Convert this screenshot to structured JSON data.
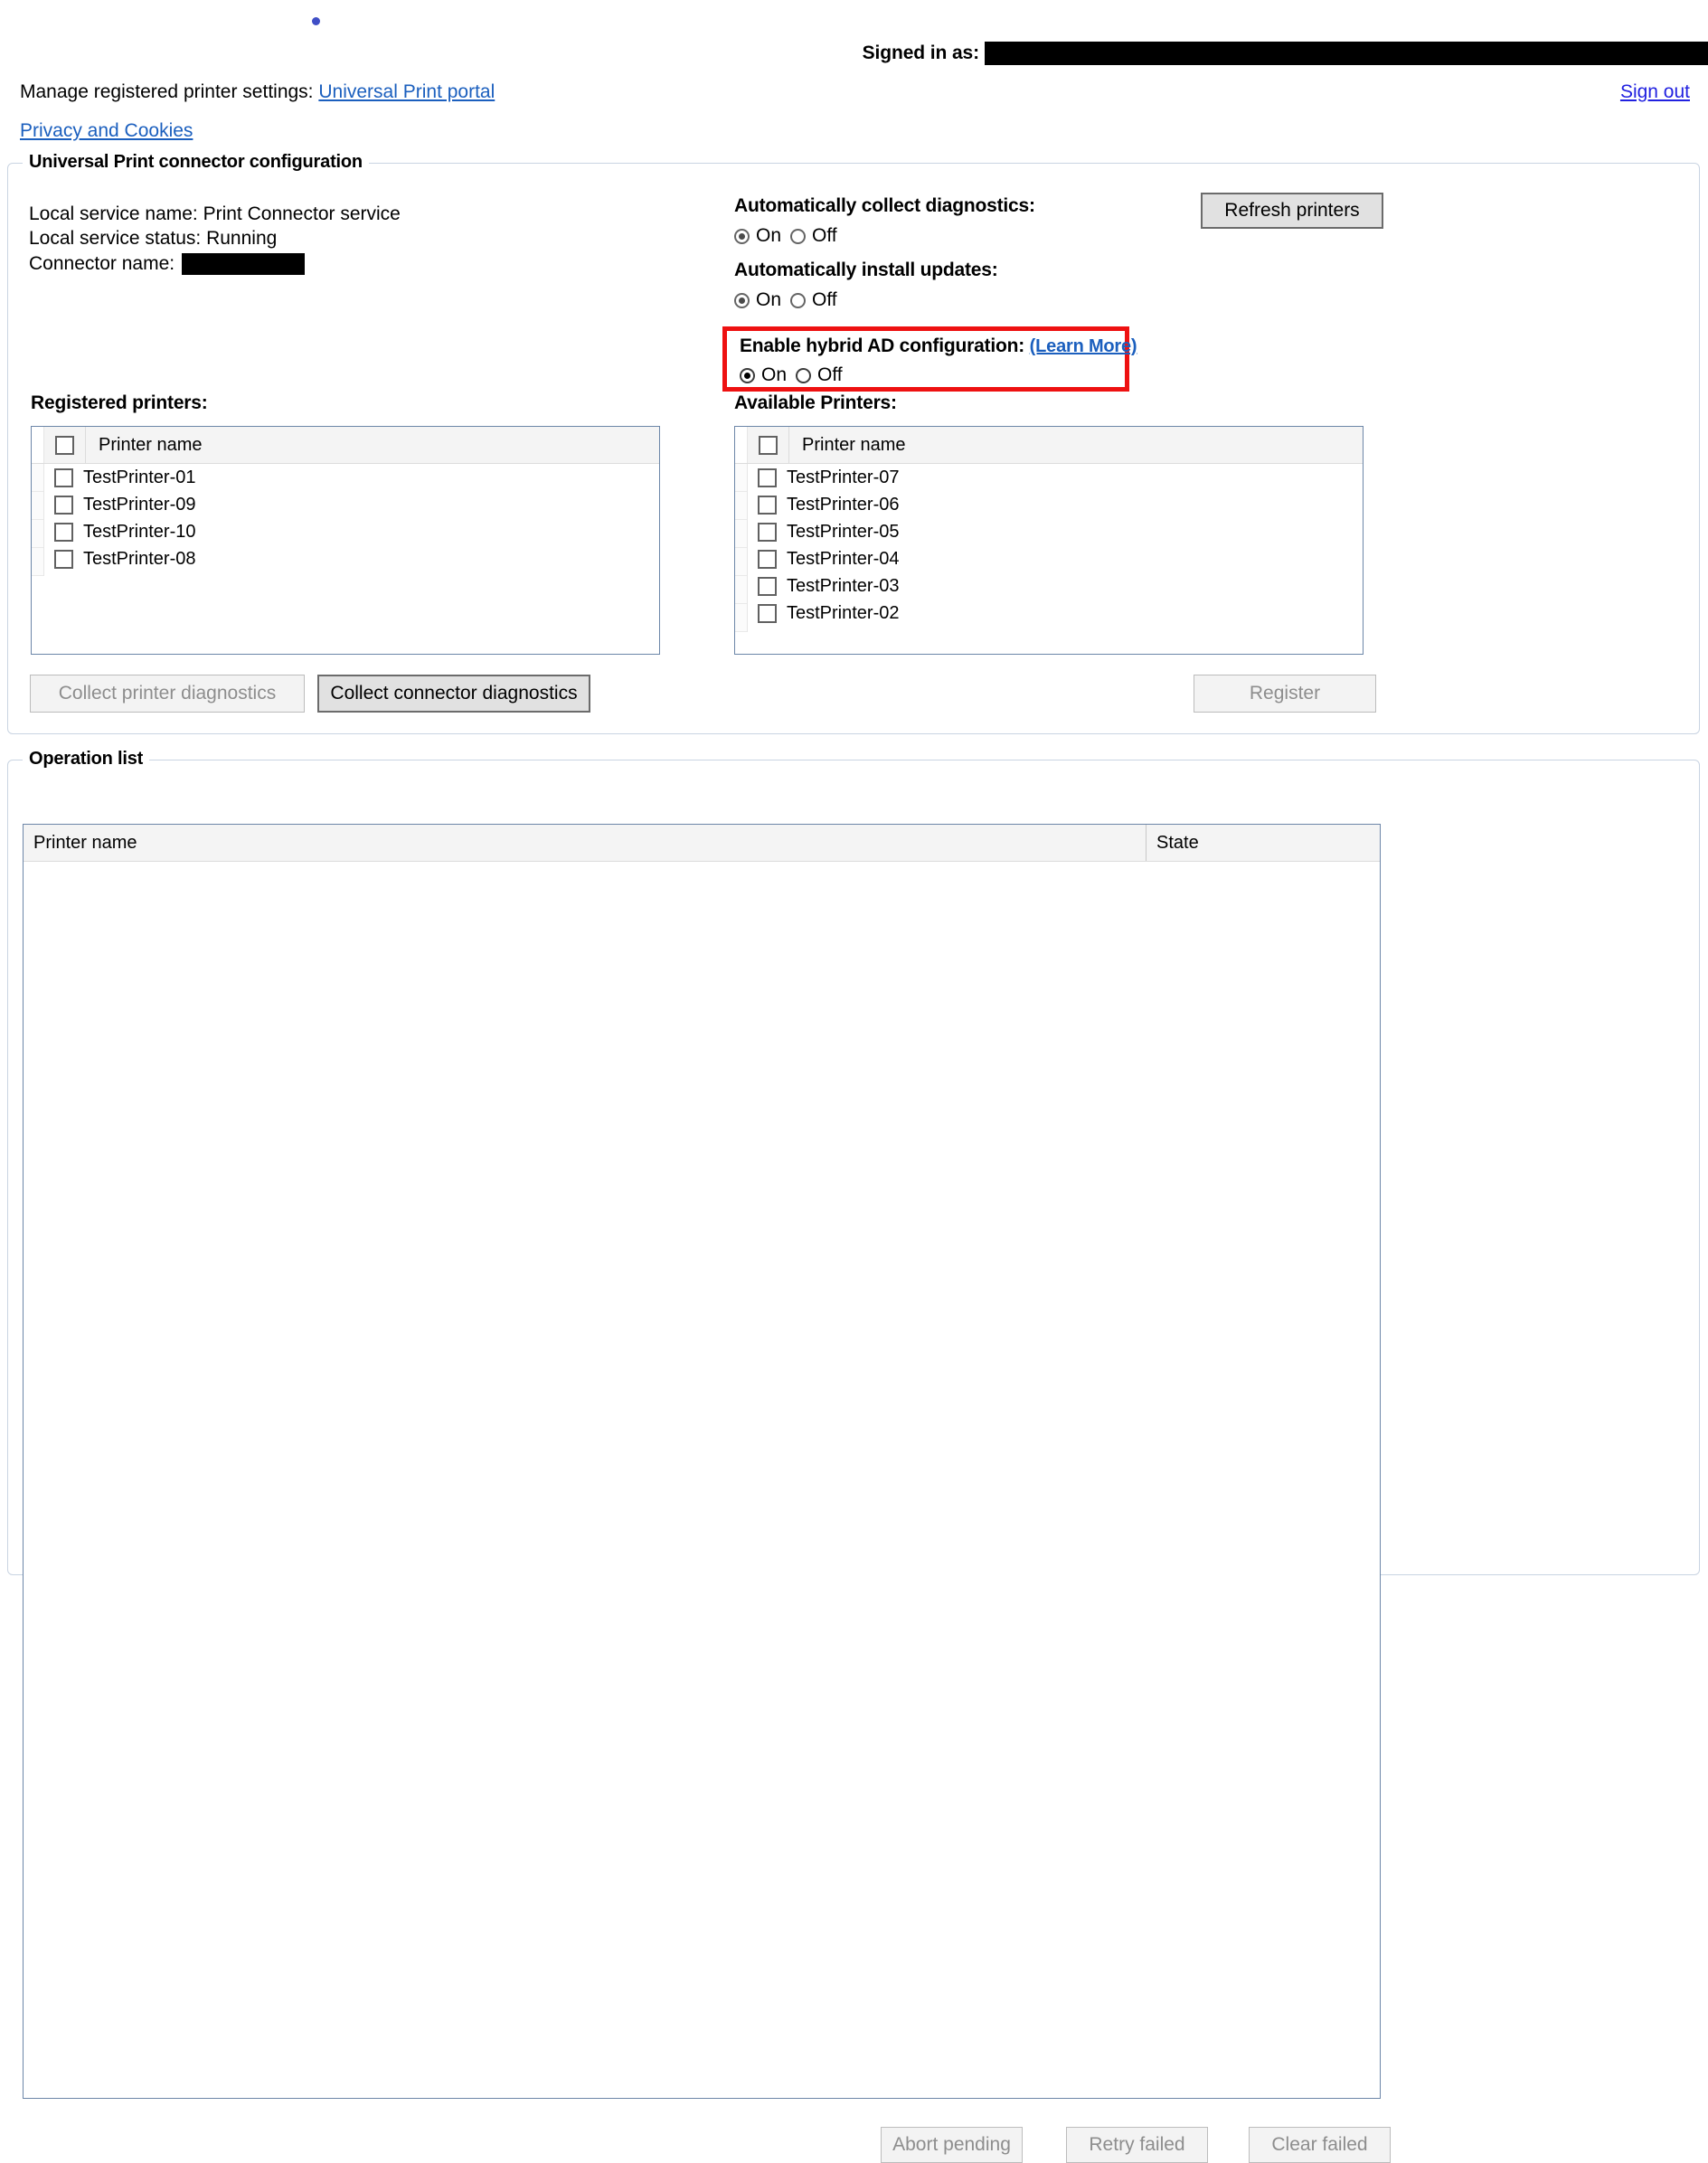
{
  "header": {
    "signed_in_label": "Signed in as:",
    "signed_in_value_redacted": "",
    "manage_prefix": "Manage registered printer settings:",
    "portal_link": "Universal Print portal",
    "sign_out": "Sign out",
    "privacy_link": "Privacy and Cookies"
  },
  "connector": {
    "legend": "Universal Print connector configuration",
    "local_service_name": "Local service name: Print Connector service",
    "local_service_status": "Local service status: Running",
    "connector_name_label": "Connector name:",
    "connector_name_value_redacted": "",
    "refresh_button": "Refresh printers",
    "options": [
      {
        "title": "Automatically collect diagnostics:",
        "on_label": "On",
        "off_label": "Off",
        "selected": "On"
      },
      {
        "title": "Automatically install updates:",
        "on_label": "On",
        "off_label": "Off",
        "selected": "On"
      },
      {
        "title": "Enable hybrid AD configuration:",
        "learn_more": "(Learn More)",
        "on_label": "On",
        "off_label": "Off",
        "selected": "On",
        "highlight_color": "#ee1111"
      }
    ],
    "registered": {
      "label": "Registered printers:",
      "column_header": "Printer name",
      "rows": [
        "TestPrinter-01",
        "TestPrinter-09",
        "TestPrinter-10",
        "TestPrinter-08"
      ]
    },
    "available": {
      "label": "Available Printers:",
      "column_header": "Printer name",
      "rows": [
        "TestPrinter-07",
        "TestPrinter-06",
        "TestPrinter-05",
        "TestPrinter-04",
        "TestPrinter-03",
        "TestPrinter-02"
      ]
    },
    "collect_printer_diagnostics": "Collect printer diagnostics",
    "collect_connector_diagnostics": "Collect connector diagnostics",
    "register_button": "Register"
  },
  "operations": {
    "legend": "Operation list",
    "columns": [
      "Printer name",
      "State"
    ],
    "rows": [],
    "abort_button": "Abort pending",
    "retry_button": "Retry failed",
    "clear_button": "Clear failed"
  }
}
